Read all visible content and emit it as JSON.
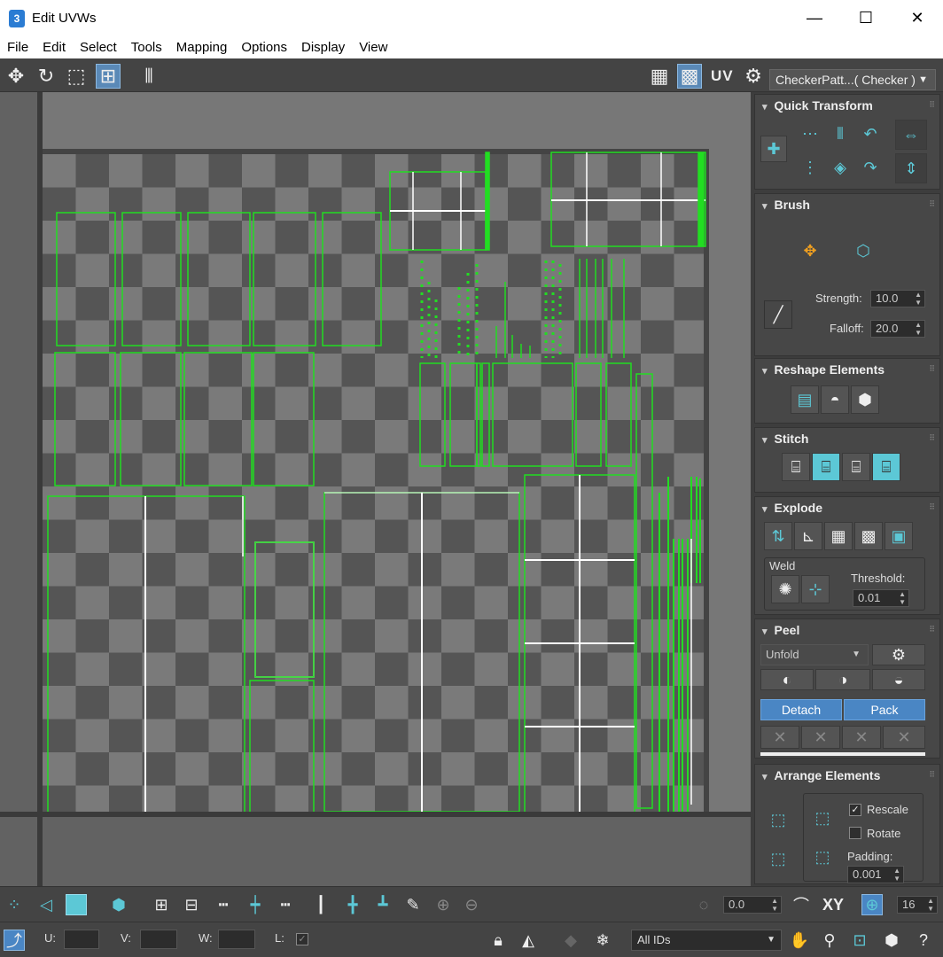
{
  "window": {
    "title": "Edit UVWs",
    "app_badge": "3",
    "minimize": "—",
    "maximize": "☐",
    "close": "✕"
  },
  "menu": [
    "File",
    "Edit",
    "Select",
    "Tools",
    "Mapping",
    "Options",
    "Display",
    "View"
  ],
  "toolbar": {
    "uv_label": "UV",
    "texture_dropdown": "CheckerPatt...( Checker )",
    "texture_dropdown_arrow": "▼"
  },
  "panel": {
    "quick_transform": {
      "title": "Quick Transform"
    },
    "brush": {
      "title": "Brush",
      "strength_label": "Strength:",
      "strength_value": "10.0",
      "falloff_label": "Falloff:",
      "falloff_value": "20.0"
    },
    "reshape": {
      "title": "Reshape Elements"
    },
    "stitch": {
      "title": "Stitch"
    },
    "explode": {
      "title": "Explode",
      "weld_label": "Weld",
      "threshold_label": "Threshold:",
      "threshold_value": "0.01"
    },
    "peel": {
      "title": "Peel",
      "mode_value": "Unfold",
      "detach_label": "Detach",
      "pack_label": "Pack"
    },
    "arrange": {
      "title": "Arrange Elements",
      "rescale_label": "Rescale",
      "rescale_checked": true,
      "rotate_label": "Rotate",
      "rotate_checked": false,
      "padding_label": "Padding:",
      "padding_value": "0.001"
    }
  },
  "status": {
    "rotation_value": "0.0",
    "xy_label": "XY",
    "grid_value": "16",
    "u_label": "U:",
    "v_label": "V:",
    "w_label": "W:",
    "l_label": "L:",
    "ids_dropdown": "All IDs"
  },
  "colors": {
    "accent": "#5cc8d6",
    "uv_edge": "#22dd22",
    "uv_selected": "#ffffff",
    "button_blue": "#4a86c4"
  }
}
